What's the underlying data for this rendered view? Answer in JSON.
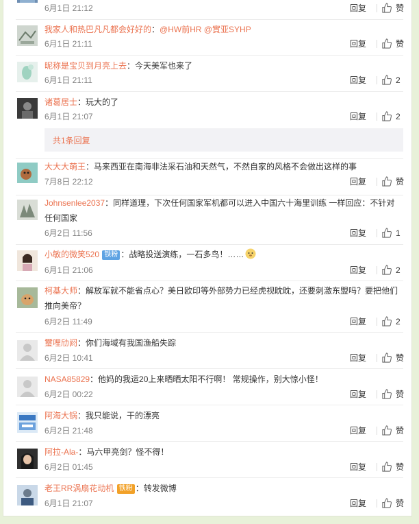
{
  "ui": {
    "reply_label": "回复",
    "like_zan_label": "赞"
  },
  "sub_replies": {
    "label": "共1条回复"
  },
  "comments": [
    {
      "username": "",
      "text": "",
      "time": "6月1日 21:12",
      "likes": ""
    },
    {
      "username": "我家人和热巴凡凡都会好好的",
      "sep": "：",
      "text_mentions": "@HW前HR @實亚SYHP",
      "time": "6月1日 21:11",
      "likes": ""
    },
    {
      "username": "昵称是宝贝到月亮上去",
      "text": "：今天美军也来了",
      "time": "6月1日 21:11",
      "likes": "2"
    },
    {
      "username": "诸葛居士",
      "text": "：玩大的了",
      "time": "6月1日 21:07",
      "likes": "2"
    },
    {
      "username": "大大大萌王",
      "text": "：马来西亚在南海非法采石油和天然气，不然自家的风格不会做出这样的事",
      "time": "7月8日 22:12",
      "likes": ""
    },
    {
      "username": "Johnsenlee2037",
      "text": "：同样道理，下次任何国家军机都可以进入中国六十海里训练 一样回应：不针对任何国家",
      "time": "6月2日 11:56",
      "likes": "1"
    },
    {
      "username": "小敏的微笑520",
      "badge": "铁粉",
      "text": "：战略投送演练，一石多鸟！……",
      "emoji": "doge-emoji",
      "time": "6月1日 21:06",
      "likes": "2"
    },
    {
      "username": "柯基大师",
      "text": "：解放军就不能省点心？美日欧印等外部势力已经虎视眈眈，还要刺激东盟吗？要把他们推向美帝？",
      "time": "6月2日 11:49",
      "likes": "2"
    },
    {
      "username": "璽哩劤阏",
      "text": "：你们海域有我国渔船失踪",
      "time": "6月2日 10:41",
      "likes": ""
    },
    {
      "username": "NASA85829",
      "text": "：他妈的我运20上来晒晒太阳不行啊！ 常规操作，别大惊小怪！",
      "time": "6月2日 00:22",
      "likes": ""
    },
    {
      "username": "阿海大锅",
      "text": "：我只能说，干的漂亮",
      "time": "6月2日 21:48",
      "likes": ""
    },
    {
      "username": "阿拉-Ala-",
      "text": "：马六甲亮剑？怪不得！",
      "time": "6月2日 01:45",
      "likes": ""
    },
    {
      "username": "老王RR涡扇花动机",
      "badge": "铁粉",
      "text": "：转发微博",
      "time": "6月1日 21:07",
      "likes": ""
    }
  ],
  "colors": {
    "accent": "#eb7350",
    "background": "#e8f1d9",
    "muted": "#808080"
  }
}
